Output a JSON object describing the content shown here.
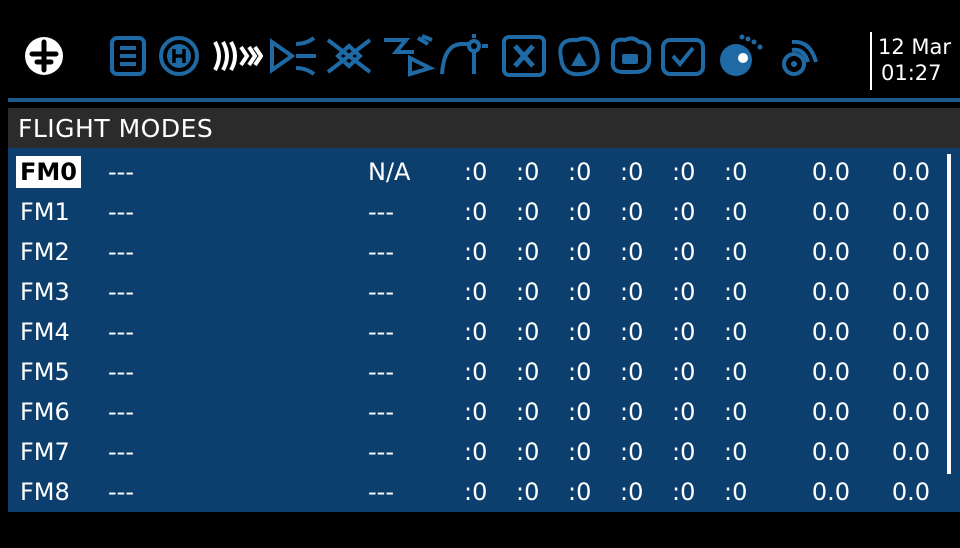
{
  "topbar": {
    "icons": [
      "radio-menu-icon",
      "model-menu-icon",
      "heli-icon",
      "flight-modes-icon",
      "inputs-icon",
      "mixes-icon",
      "outputs-icon",
      "curves-icon",
      "logical-switches-icon",
      "special-functions-icon",
      "custom-scripts-icon",
      "telemetry-icon",
      "checklist-icon",
      "timer-icon",
      "telemetry-signal-icon"
    ],
    "date": "12 Mar",
    "time": "01:27",
    "accent_color": "#1f6aa5"
  },
  "title": "FLIGHT MODES",
  "colors": {
    "list_bg": "#0c3f6d",
    "title_bg": "#2b2b2b",
    "text": "#ffffff"
  },
  "modes": [
    {
      "name": "FM0",
      "label": "---",
      "switch": "N/A",
      "trims": [
        ":0",
        ":0",
        ":0",
        ":0",
        ":0",
        ":0"
      ],
      "fade_in": "0.0",
      "fade_out": "0.0",
      "selected": true
    },
    {
      "name": "FM1",
      "label": "---",
      "switch": "---",
      "trims": [
        ":0",
        ":0",
        ":0",
        ":0",
        ":0",
        ":0"
      ],
      "fade_in": "0.0",
      "fade_out": "0.0"
    },
    {
      "name": "FM2",
      "label": "---",
      "switch": "---",
      "trims": [
        ":0",
        ":0",
        ":0",
        ":0",
        ":0",
        ":0"
      ],
      "fade_in": "0.0",
      "fade_out": "0.0"
    },
    {
      "name": "FM3",
      "label": "---",
      "switch": "---",
      "trims": [
        ":0",
        ":0",
        ":0",
        ":0",
        ":0",
        ":0"
      ],
      "fade_in": "0.0",
      "fade_out": "0.0"
    },
    {
      "name": "FM4",
      "label": "---",
      "switch": "---",
      "trims": [
        ":0",
        ":0",
        ":0",
        ":0",
        ":0",
        ":0"
      ],
      "fade_in": "0.0",
      "fade_out": "0.0"
    },
    {
      "name": "FM5",
      "label": "---",
      "switch": "---",
      "trims": [
        ":0",
        ":0",
        ":0",
        ":0",
        ":0",
        ":0"
      ],
      "fade_in": "0.0",
      "fade_out": "0.0"
    },
    {
      "name": "FM6",
      "label": "---",
      "switch": "---",
      "trims": [
        ":0",
        ":0",
        ":0",
        ":0",
        ":0",
        ":0"
      ],
      "fade_in": "0.0",
      "fade_out": "0.0"
    },
    {
      "name": "FM7",
      "label": "---",
      "switch": "---",
      "trims": [
        ":0",
        ":0",
        ":0",
        ":0",
        ":0",
        ":0"
      ],
      "fade_in": "0.0",
      "fade_out": "0.0"
    },
    {
      "name": "FM8",
      "label": "---",
      "switch": "---",
      "trims": [
        ":0",
        ":0",
        ":0",
        ":0",
        ":0",
        ":0"
      ],
      "fade_in": "0.0",
      "fade_out": "0.0"
    }
  ]
}
